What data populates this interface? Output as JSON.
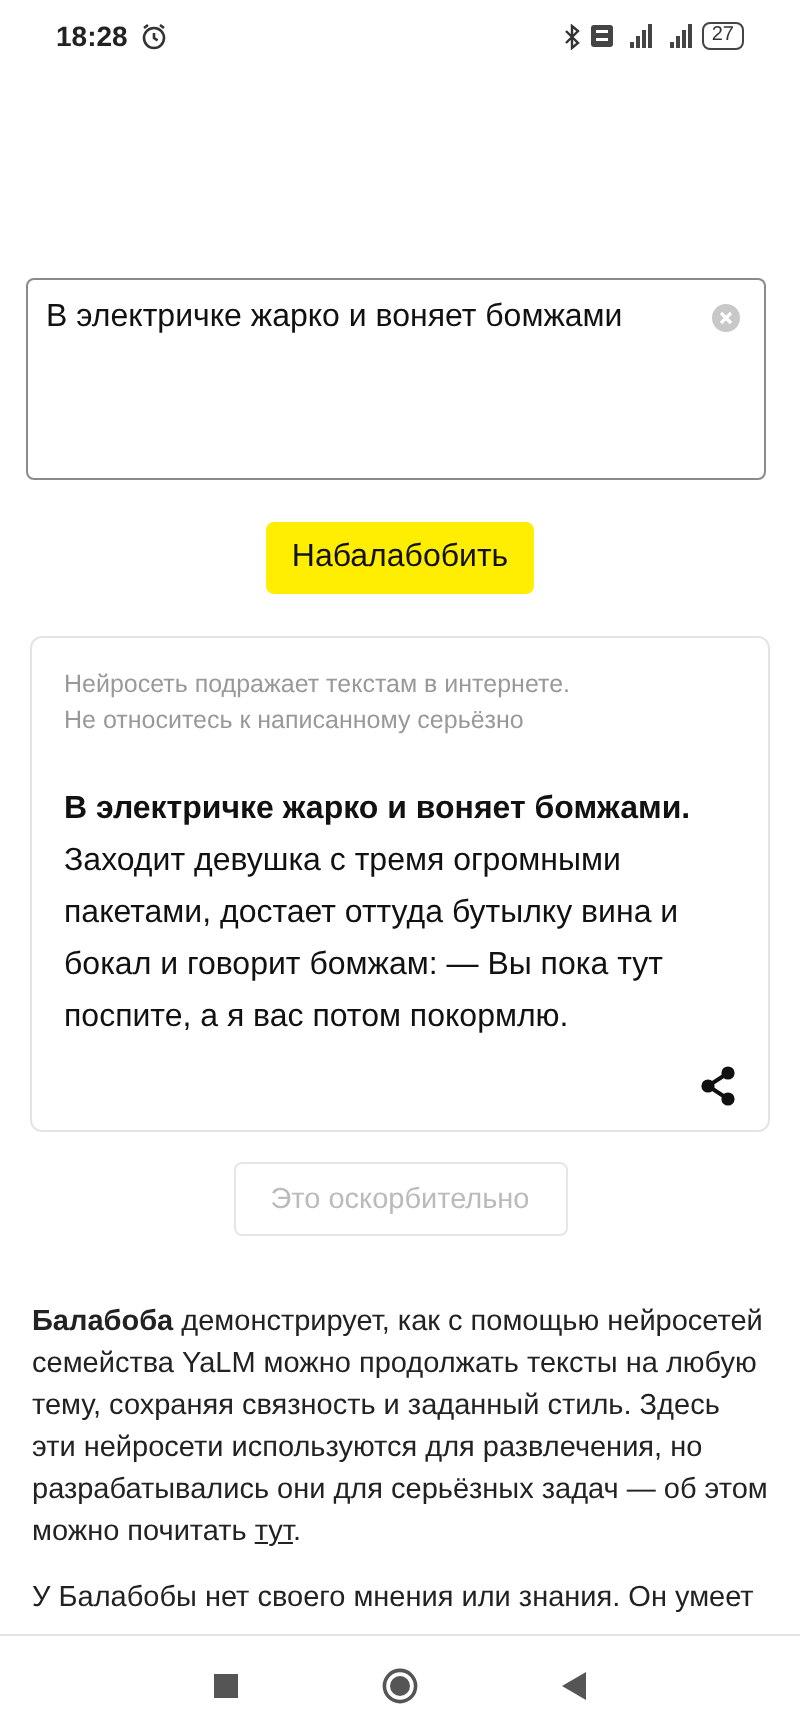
{
  "status_bar": {
    "time": "18:28",
    "battery": "27"
  },
  "prompt": {
    "value": "В электричке жарко и воняет бомжами"
  },
  "generate_button": {
    "label": "Набалабобить"
  },
  "result": {
    "disclaimer": [
      "Нейросеть подражает текстам в интернете.",
      "Не относитесь к написанному серьёзно"
    ],
    "lead": "В электричке жарко и воняет бомжами.",
    "body": "Заходит девушка с тремя огромными пакетами, достает оттуда бутылку вина и бокал и говорит бомжам: — Вы пока тут поспите, а я вас потом покормлю."
  },
  "report_button": {
    "label": "Это оскорбительно",
    "disabled": true
  },
  "about": {
    "text": "**Балабоба** демонстрирует, как с помощью нейросетей семейства YaLM можно продолжать тексты на любую тему, сохраняя связность и заданный стиль. Здесь эти нейросети используются для развлечения, но разрабатывались они для серьёзных задач — об этом можно почитать ",
    "link": "тут",
    "after": "."
  },
  "next_paragraph": "У Балабобы нет своего мнения или знания. Он умеет"
}
